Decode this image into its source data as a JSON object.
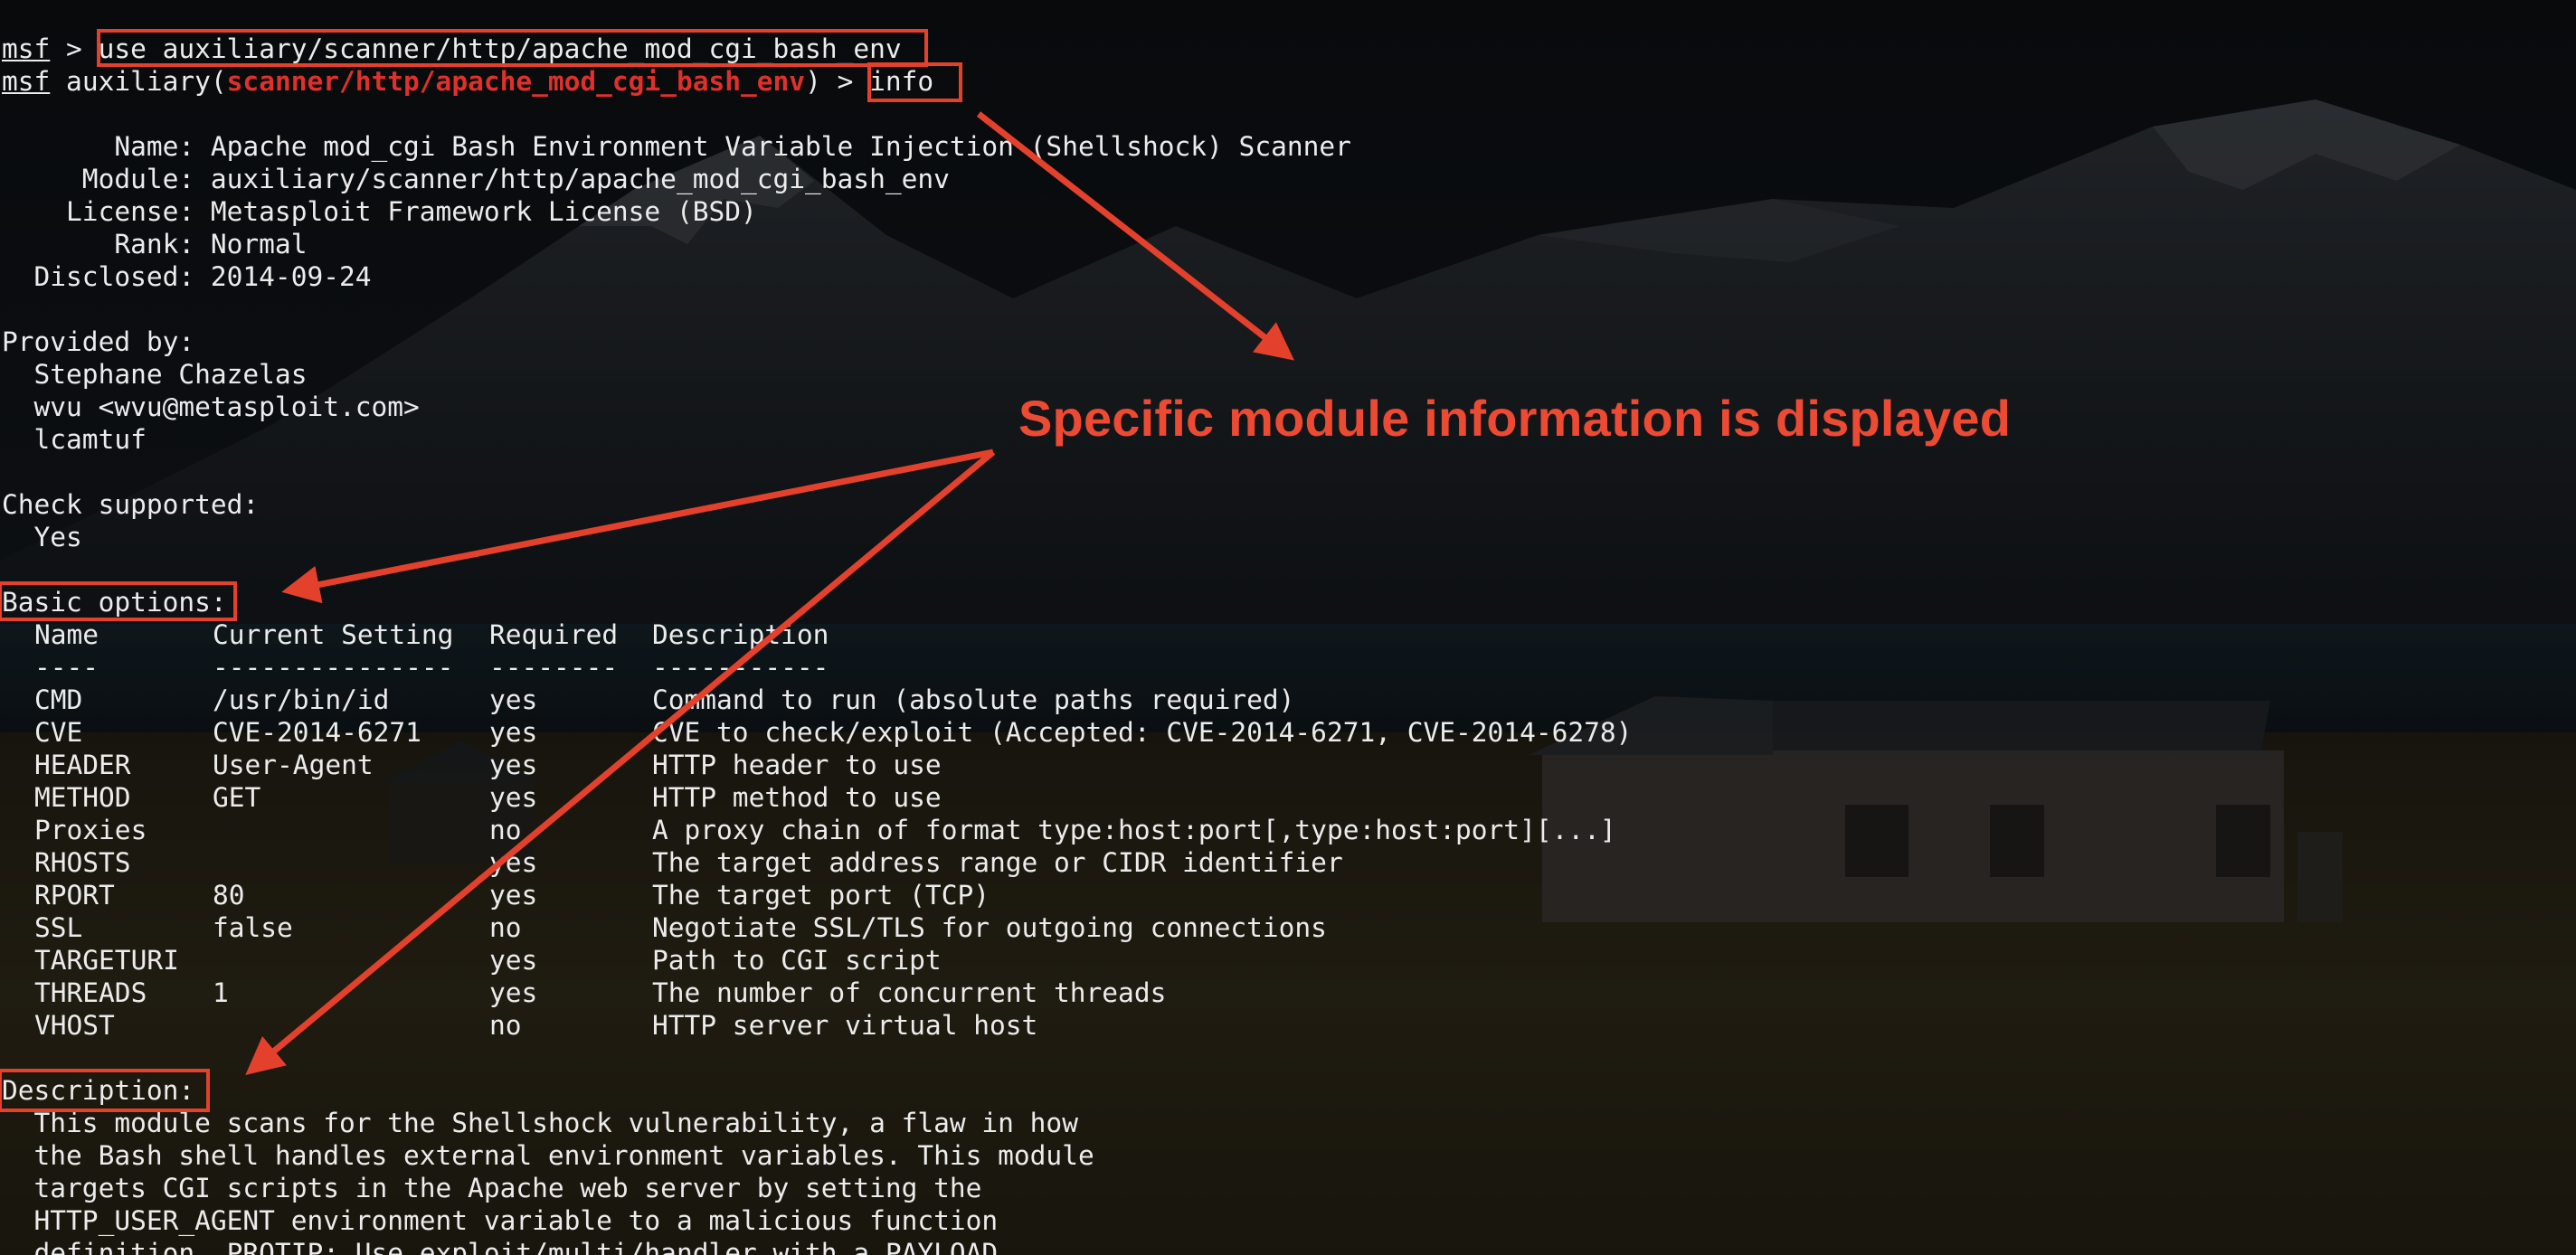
{
  "prompt": {
    "msf": "msf",
    "gt": " > ",
    "use_command": "use auxiliary/scanner/http/apache_mod_cgi_bash_env",
    "aux_prefix": " auxiliary(",
    "aux_module": "scanner/http/apache_mod_cgi_bash_env",
    "aux_suffix": ") > ",
    "info_command": "info"
  },
  "info": {
    "name_line": "       Name: Apache mod_cgi Bash Environment Variable Injection (Shellshock) Scanner",
    "module_line": "     Module: auxiliary/scanner/http/apache_mod_cgi_bash_env",
    "license_line": "    License: Metasploit Framework License (BSD)",
    "rank_line": "       Rank: Normal",
    "disclosed_line": "  Disclosed: 2014-09-24"
  },
  "provided_by": {
    "heading": "Provided by:",
    "authors": [
      "  Stephane Chazelas",
      "  wvu <wvu@metasploit.com>",
      "  lcamtuf"
    ]
  },
  "check": {
    "heading": "Check supported:",
    "value": "  Yes"
  },
  "options": {
    "heading": "Basic options:",
    "headers": [
      "Name",
      "Current Setting",
      "Required",
      "Description"
    ],
    "separators": [
      "----",
      "---------------",
      "--------",
      "-----------"
    ],
    "rows": [
      [
        "CMD",
        "/usr/bin/id",
        "yes",
        "Command to run (absolute paths required)"
      ],
      [
        "CVE",
        "CVE-2014-6271",
        "yes",
        "CVE to check/exploit (Accepted: CVE-2014-6271, CVE-2014-6278)"
      ],
      [
        "HEADER",
        "User-Agent",
        "yes",
        "HTTP header to use"
      ],
      [
        "METHOD",
        "GET",
        "yes",
        "HTTP method to use"
      ],
      [
        "Proxies",
        "",
        "no",
        "A proxy chain of format type:host:port[,type:host:port][...]"
      ],
      [
        "RHOSTS",
        "",
        "yes",
        "The target address range or CIDR identifier"
      ],
      [
        "RPORT",
        "80",
        "yes",
        "The target port (TCP)"
      ],
      [
        "SSL",
        "false",
        "no",
        "Negotiate SSL/TLS for outgoing connections"
      ],
      [
        "TARGETURI",
        "",
        "yes",
        "Path to CGI script"
      ],
      [
        "THREADS",
        "1",
        "yes",
        "The number of concurrent threads"
      ],
      [
        "VHOST",
        "",
        "no",
        "HTTP server virtual host"
      ]
    ]
  },
  "description": {
    "heading": "Description:",
    "lines": [
      "  This module scans for the Shellshock vulnerability, a flaw in how",
      "  the Bash shell handles external environment variables. This module",
      "  targets CGI scripts in the Apache web server by setting the",
      "  HTTP_USER_AGENT environment variable to a malicious function",
      "  definition. PROTIP: Use exploit/multi/handler with a PAYLOAD"
    ]
  },
  "annotation": {
    "text": "Specific module information is displayed",
    "color": "#ec4a33"
  },
  "colors": {
    "terminal_text": "#ececec",
    "module_red": "#e0302c",
    "highlight_box": "#e3412c"
  }
}
